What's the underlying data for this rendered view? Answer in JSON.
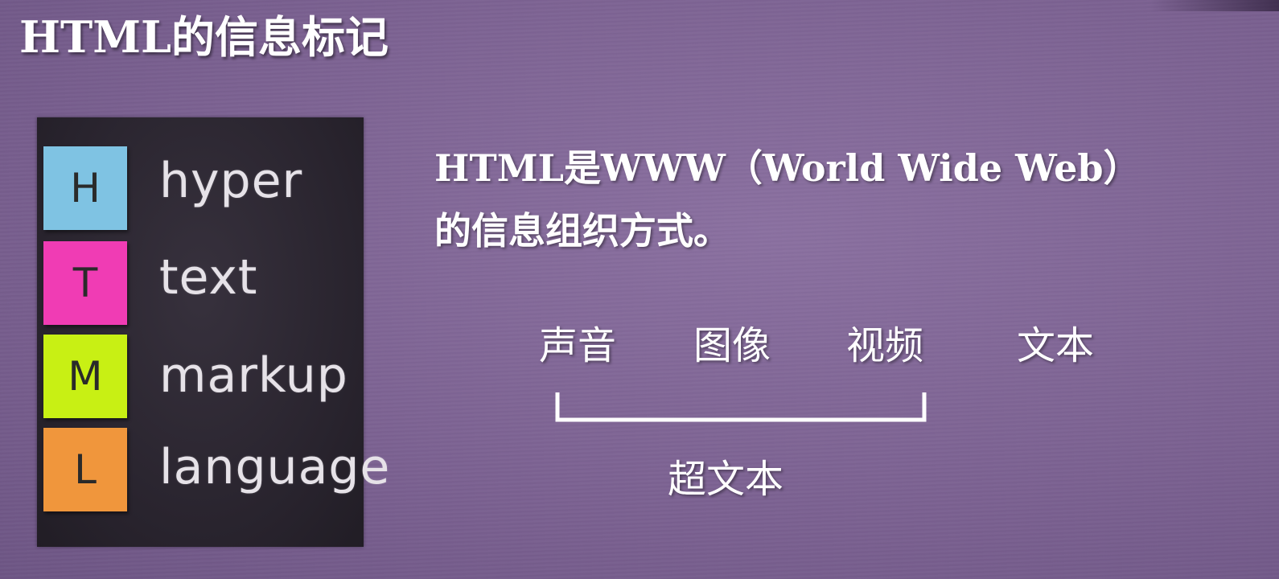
{
  "slide": {
    "title": "HTML的信息标记"
  },
  "board": {
    "notes": [
      {
        "letter": "H",
        "word": "hyper",
        "color": "#7fc3e3"
      },
      {
        "letter": "T",
        "word": "text",
        "color": "#f03cb4"
      },
      {
        "letter": "M",
        "word": "markup",
        "color": "#c8f014"
      },
      {
        "letter": "L",
        "word": "language",
        "color": "#f0963c"
      }
    ]
  },
  "definition": {
    "line1": "HTML是WWW（World Wide Web）",
    "line2": "的信息组织方式。"
  },
  "media_types": {
    "sound": "声音",
    "image": "图像",
    "video": "视频",
    "text": "文本"
  },
  "hypertext": {
    "label": "超文本"
  }
}
